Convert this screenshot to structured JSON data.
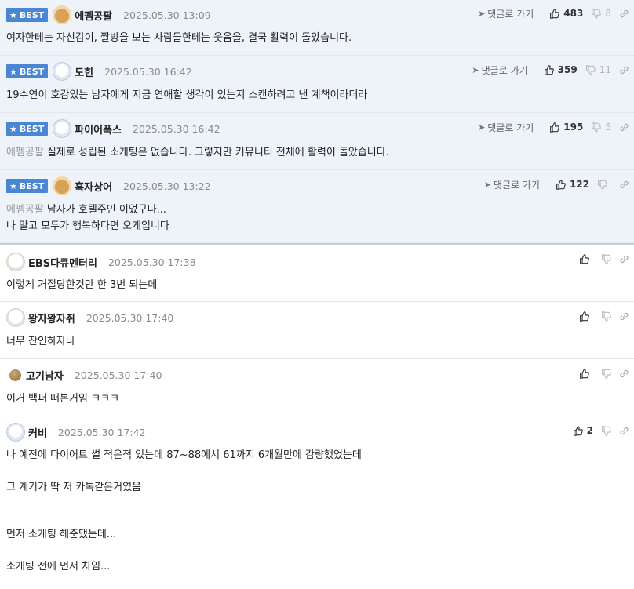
{
  "comments": [
    {
      "best": true,
      "badge": "BEST",
      "nick": "에펨공팔",
      "date": "2025.05.30 13:09",
      "goto": "댓글로 가기",
      "up": "483",
      "down": "8",
      "mention": "",
      "text": "여자한테는 자신감이, 짤방을 보는 사람들한테는 웃음을, 결국 활력이 돌았습니다."
    },
    {
      "best": true,
      "badge": "BEST",
      "nick": "도힌",
      "date": "2025.05.30 16:42",
      "goto": "댓글로 가기",
      "up": "359",
      "down": "11",
      "mention": "",
      "text": "19수연이 호감있는 남자에게 지금 연애할 생각이 있는지 스캔하려고 낸 계책이라더라"
    },
    {
      "best": true,
      "badge": "BEST",
      "nick": "파이어폭스",
      "date": "2025.05.30 16:42",
      "goto": "댓글로 가기",
      "up": "195",
      "down": "5",
      "mention": "에펨공팔",
      "text": "실제로 성립된 소개팅은 없습니다. 그렇지만 커뮤니티 전체에 활력이 돌았습니다."
    },
    {
      "best": true,
      "badge": "BEST",
      "nick": "흑자상어",
      "date": "2025.05.30 13:22",
      "goto": "댓글로 가기",
      "up": "122",
      "down": "",
      "mention": "에펨공팔",
      "text": "남자가 호텔주인 이었구나...\n나 말고 모두가 행복하다면 오케입니다"
    },
    {
      "best": false,
      "nick": "EBS다큐멘터리",
      "date": "2025.05.30 17:38",
      "up": "",
      "down": "",
      "mention": "",
      "text": "이렇게 거절당한것만 한 3번 되는데"
    },
    {
      "best": false,
      "nick": "왕자왕자쥐",
      "date": "2025.05.30 17:40",
      "up": "",
      "down": "",
      "mention": "",
      "text": "너무 잔인하자나"
    },
    {
      "best": false,
      "nick": "고기남자",
      "date": "2025.05.30 17:40",
      "up": "",
      "down": "",
      "mention": "",
      "text": "이거 백퍼 떠본거임 ㅋㅋㅋ"
    },
    {
      "best": false,
      "nick": "커비",
      "date": "2025.05.30 17:42",
      "up": "2",
      "down": "",
      "mention": "",
      "text": "나 예전에 다이어트 썰 적은적 있는데 87~88에서 61까지 6개월만에 감량했었는데\n\n그 계기가 딱 저 카톡같은거였음\n\n\n먼저 소개팅 해준댔는데...\n\n소개팅 전에 먼저 차임..."
    }
  ]
}
